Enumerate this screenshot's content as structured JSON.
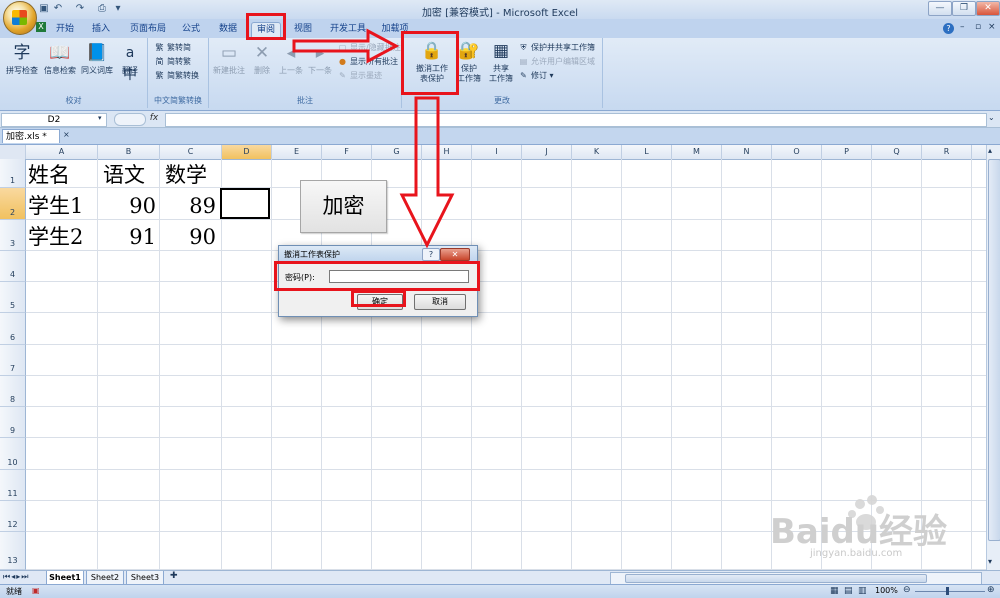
{
  "window": {
    "title": "加密  [兼容模式] - Microsoft Excel"
  },
  "tabs": [
    {
      "label": "开始"
    },
    {
      "label": "插入"
    },
    {
      "label": "页面布局"
    },
    {
      "label": "公式"
    },
    {
      "label": "数据"
    },
    {
      "label": "审阅"
    },
    {
      "label": "视图"
    },
    {
      "label": "开发工具"
    },
    {
      "label": "加载项"
    }
  ],
  "ribbon": {
    "proofing": {
      "spell": "拼写检查",
      "research": "信息检索",
      "thesaurus": "同义词库",
      "translate": "翻译",
      "label": "校对"
    },
    "chinese": {
      "t2s": "繁转简",
      "s2t": "简转繁",
      "convert": "简繁转换",
      "label": "中文简繁转换"
    },
    "comments": {
      "new": "新建批注",
      "delete": "删除",
      "prev": "上一条",
      "next": "下一条",
      "show_hide": "显示/隐藏批注",
      "show_all": "显示所有批注",
      "show_ink": "显示墨迹",
      "label": "批注"
    },
    "changes": {
      "unprotect_l1": "撤消工作",
      "unprotect_l2": "表保护",
      "protect_wb_l1": "保护",
      "protect_wb_l2": "工作簿",
      "share_l1": "共享",
      "share_l2": "工作簿",
      "protect_share": "保护并共享工作簿",
      "allow_edit": "允许用户编辑区域",
      "track": "修订",
      "label": "更改"
    }
  },
  "formula_bar": {
    "name_box": "D2",
    "fx": "fx",
    "value": ""
  },
  "workbook_tab": "加密.xls *",
  "columns": [
    "A",
    "B",
    "C",
    "D",
    "E",
    "F",
    "G",
    "H",
    "I",
    "J",
    "K",
    "L",
    "M",
    "N",
    "O",
    "P",
    "Q",
    "R"
  ],
  "rows": [
    "1",
    "2",
    "3",
    "4",
    "5",
    "6",
    "7",
    "8",
    "9",
    "10",
    "11",
    "12",
    "13"
  ],
  "cells": {
    "A1": "姓名",
    "B1": "语文",
    "C1": "数学",
    "A2": "学生1",
    "B2": "90",
    "C2": "89",
    "A3": "学生2",
    "B3": "91",
    "C3": "90"
  },
  "encrypt_button": "加密",
  "dialog": {
    "title": "撤消工作表保护",
    "password_label": "密码(P):",
    "password_value": "",
    "ok": "确定",
    "cancel": "取消"
  },
  "sheet_tabs": [
    "Sheet1",
    "Sheet2",
    "Sheet3"
  ],
  "status": {
    "ready": "就绪",
    "zoom": "100%"
  },
  "watermark": {
    "brand": "Baidu经验",
    "url": "jingyan.baidu.com"
  },
  "colors": {
    "annotation": "#e8141c",
    "selected_header": "#f1c15f",
    "ribbon": "#c7d9f0"
  }
}
